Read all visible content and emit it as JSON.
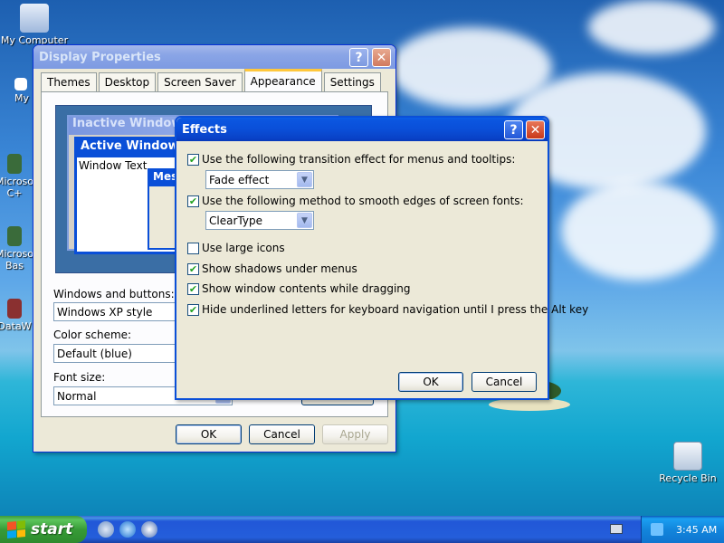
{
  "desktop": {
    "icons": [
      {
        "label": "My Computer"
      },
      {
        "label": "My"
      },
      {
        "label": "Microso C+"
      },
      {
        "label": "Microso Bas"
      },
      {
        "label": "DataW"
      },
      {
        "label": "Recycle Bin"
      }
    ]
  },
  "display_properties": {
    "title": "Display Properties",
    "help_glyph": "?",
    "close_glyph": "✕",
    "tabs": [
      {
        "label": "Themes"
      },
      {
        "label": "Desktop"
      },
      {
        "label": "Screen Saver"
      },
      {
        "label": "Appearance"
      },
      {
        "label": "Settings"
      }
    ],
    "selected_tab": "Appearance",
    "preview": {
      "inactive_title": "Inactive Window",
      "active_title": "Active Window",
      "window_text": "Window Text",
      "message_title": "Mes"
    },
    "windows_buttons_label": "Windows and buttons:",
    "windows_buttons_value": "Windows XP style",
    "color_scheme_label": "Color scheme:",
    "color_scheme_value": "Default (blue)",
    "font_size_label": "Font size:",
    "font_size_value": "Normal",
    "ok_label": "OK",
    "cancel_label": "Cancel",
    "apply_label": "Apply"
  },
  "effects": {
    "title": "Effects",
    "help_glyph": "?",
    "close_glyph": "✕",
    "options": [
      {
        "label": "Use the following transition effect for menus and tooltips:",
        "checked": true
      },
      {
        "label": "Use the following method to smooth edges of screen fonts:",
        "checked": true
      },
      {
        "label": "Use large icons",
        "checked": false
      },
      {
        "label": "Show shadows under menus",
        "checked": true
      },
      {
        "label": "Show window contents while dragging",
        "checked": true
      },
      {
        "label": "Hide underlined letters for keyboard navigation until I press the Alt key",
        "checked": true
      }
    ],
    "transition_value": "Fade effect",
    "smoothing_value": "ClearType",
    "ok_label": "OK",
    "cancel_label": "Cancel",
    "check_glyph": "✔"
  },
  "taskbar": {
    "start_label": "start",
    "clock": "3:45 AM"
  },
  "colors": {
    "titlebar_active": "#0a4fd8",
    "start_green": "#3c9a3c",
    "window_face": "#ece9d8"
  }
}
